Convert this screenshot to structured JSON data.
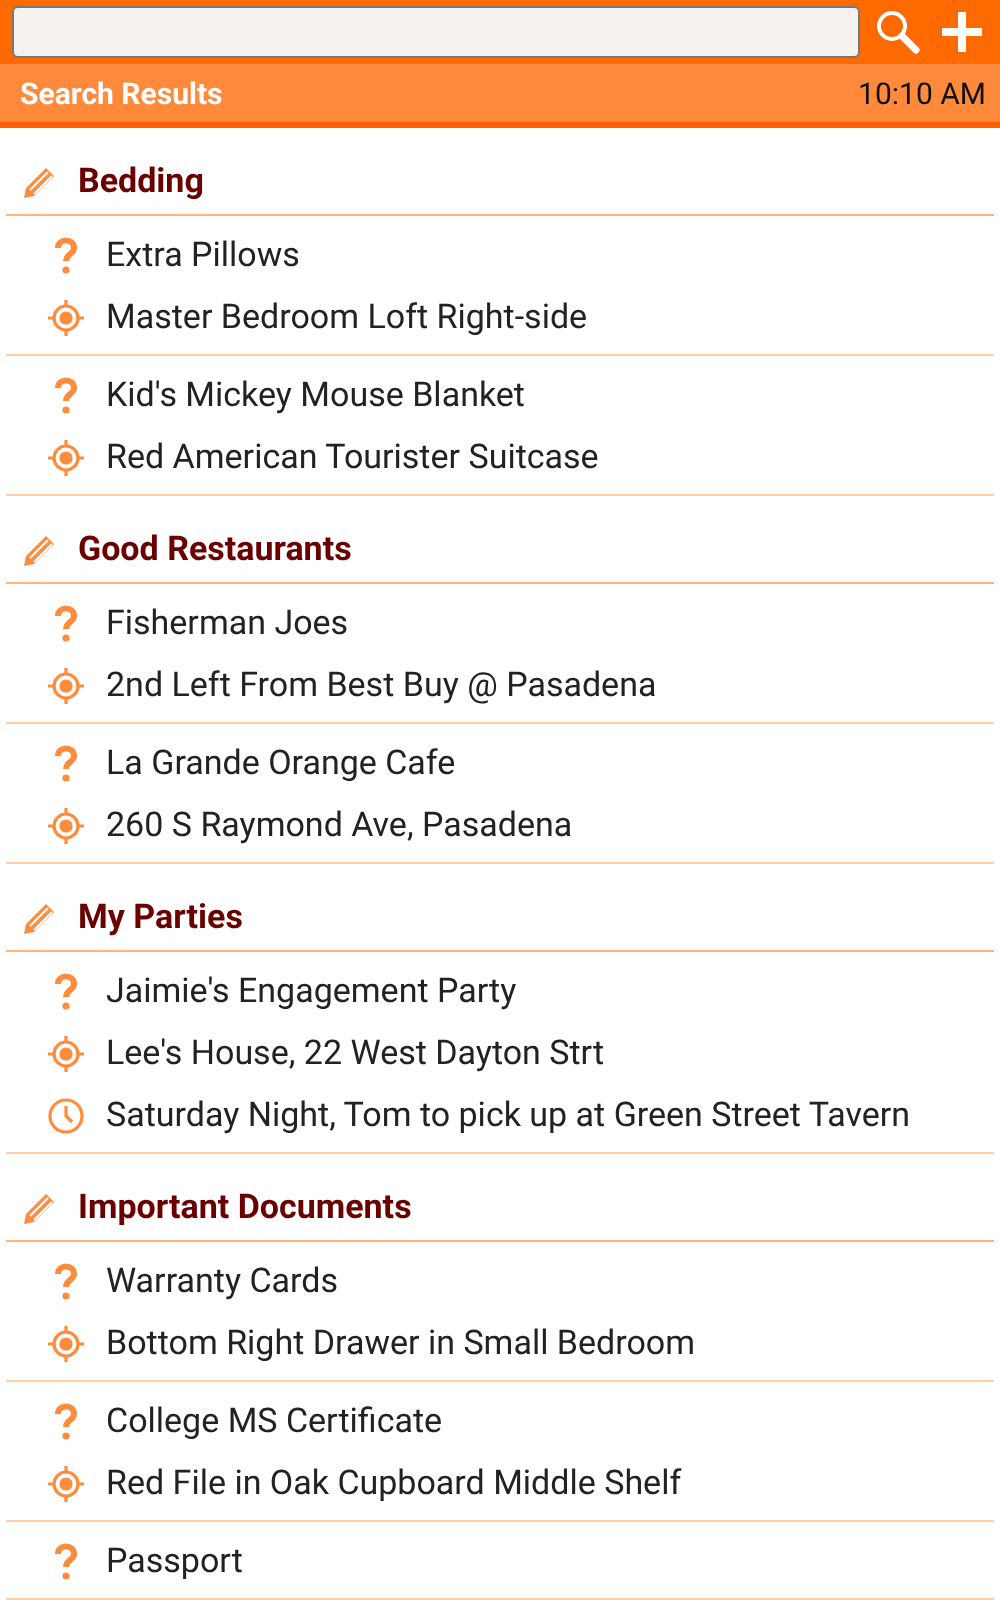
{
  "header": {
    "title": "Search Results",
    "time": "10:10 AM"
  },
  "categories": [
    {
      "name": "Bedding",
      "entries": [
        {
          "lines": [
            {
              "kind": "question",
              "text": "Extra Pillows"
            },
            {
              "kind": "location",
              "text": "Master Bedroom Loft Right-side"
            }
          ]
        },
        {
          "lines": [
            {
              "kind": "question",
              "text": "Kid's Mickey Mouse Blanket"
            },
            {
              "kind": "location",
              "text": "Red American Tourister Suitcase"
            }
          ]
        }
      ]
    },
    {
      "name": "Good Restaurants",
      "entries": [
        {
          "lines": [
            {
              "kind": "question",
              "text": "Fisherman Joes"
            },
            {
              "kind": "location",
              "text": "2nd Left From Best Buy @ Pasadena"
            }
          ]
        },
        {
          "lines": [
            {
              "kind": "question",
              "text": "La Grande Orange Cafe"
            },
            {
              "kind": "location",
              "text": "260 S Raymond Ave, Pasadena"
            }
          ]
        }
      ]
    },
    {
      "name": "My Parties",
      "entries": [
        {
          "lines": [
            {
              "kind": "question",
              "text": "Jaimie's Engagement Party"
            },
            {
              "kind": "location",
              "text": "Lee's House, 22 West Dayton Strt"
            },
            {
              "kind": "time",
              "text": "Saturday Night, Tom to pick up at Green Street Tavern"
            }
          ]
        }
      ]
    },
    {
      "name": "Important Documents",
      "entries": [
        {
          "lines": [
            {
              "kind": "question",
              "text": "Warranty Cards"
            },
            {
              "kind": "location",
              "text": "Bottom Right Drawer in Small Bedroom"
            }
          ]
        },
        {
          "lines": [
            {
              "kind": "question",
              "text": "College MS Certificate"
            },
            {
              "kind": "location",
              "text": "Red File in Oak Cupboard Middle Shelf"
            }
          ]
        },
        {
          "lines": [
            {
              "kind": "question",
              "text": "Passport"
            }
          ]
        }
      ]
    }
  ]
}
